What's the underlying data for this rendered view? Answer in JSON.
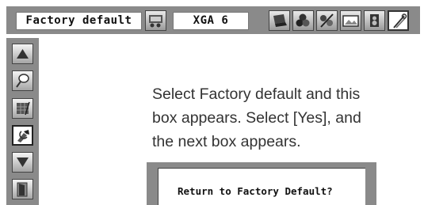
{
  "menu_bar": {
    "title": "Factory default",
    "source": "XGA 6",
    "icons": [
      "computer-input-icon",
      "laptop-icon",
      "image-adjust-icon",
      "image-select-icon",
      "screen-icon",
      "sound-icon",
      "setting-icon"
    ]
  },
  "sidebar": {
    "items": [
      "up-arrow-icon",
      "bulb-icon",
      "grid-icon",
      "factory-default-icon",
      "down-arrow-icon",
      "exit-door-icon"
    ],
    "selected": "factory-default-icon"
  },
  "caption": {
    "line1": "Select Factory default and this",
    "line2": "box appears. Select [Yes], and",
    "line3": "the next box appears."
  },
  "dialog": {
    "question": "Return to Factory Default?"
  }
}
